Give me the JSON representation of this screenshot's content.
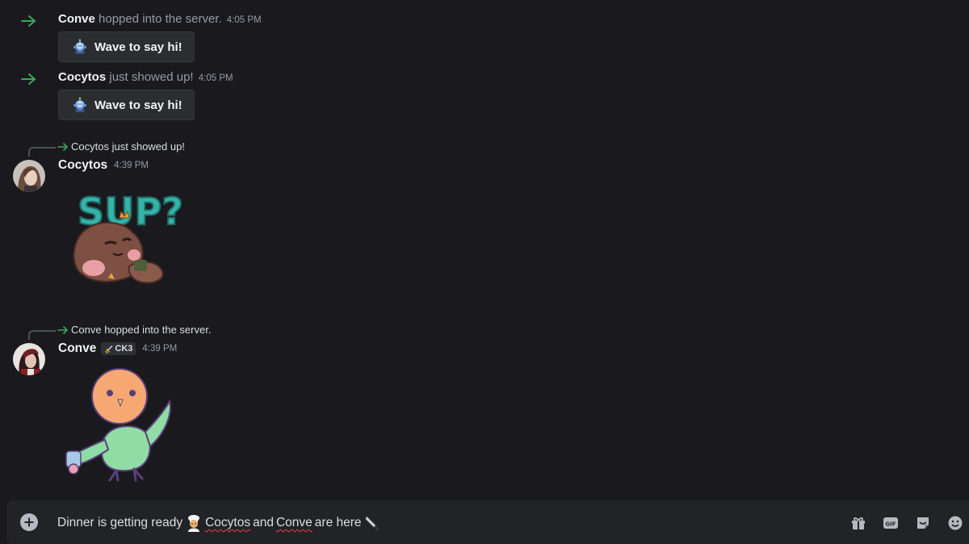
{
  "messages": {
    "join1": {
      "user": "Conve",
      "text": "hopped into the server.",
      "time": "4:05 PM",
      "wave_label": "Wave to say hi!"
    },
    "join2": {
      "user": "Cocytos",
      "text": "just showed up!",
      "time": "4:05 PM",
      "wave_label": "Wave to say hi!"
    },
    "msg1": {
      "reply_text": "Cocytos just showed up!",
      "user": "Cocytos",
      "time": "4:39 PM",
      "sticker_text": "SUP?"
    },
    "msg2": {
      "reply_text": "Conve hopped into the server.",
      "user": "Conve",
      "tag": "CK3",
      "time": "4:39 PM"
    }
  },
  "composer": {
    "part1": "Dinner is getting ready",
    "name1": "Cocytos",
    "and": "and",
    "name2": "Conve",
    "part2": "are here"
  },
  "colors": {
    "background": "#1a1a1e",
    "join_arrow": "#3ba55c",
    "username": "#f2f3f5",
    "muted": "#949ba4"
  },
  "icons": [
    "join-arrow-icon",
    "wave-sticker-icon",
    "reply-arrow-icon",
    "sword-tag-icon",
    "add-icon",
    "gift-icon",
    "gif-icon",
    "sticker-icon",
    "emoji-icon",
    "chef-emoji",
    "knife-emoji"
  ]
}
